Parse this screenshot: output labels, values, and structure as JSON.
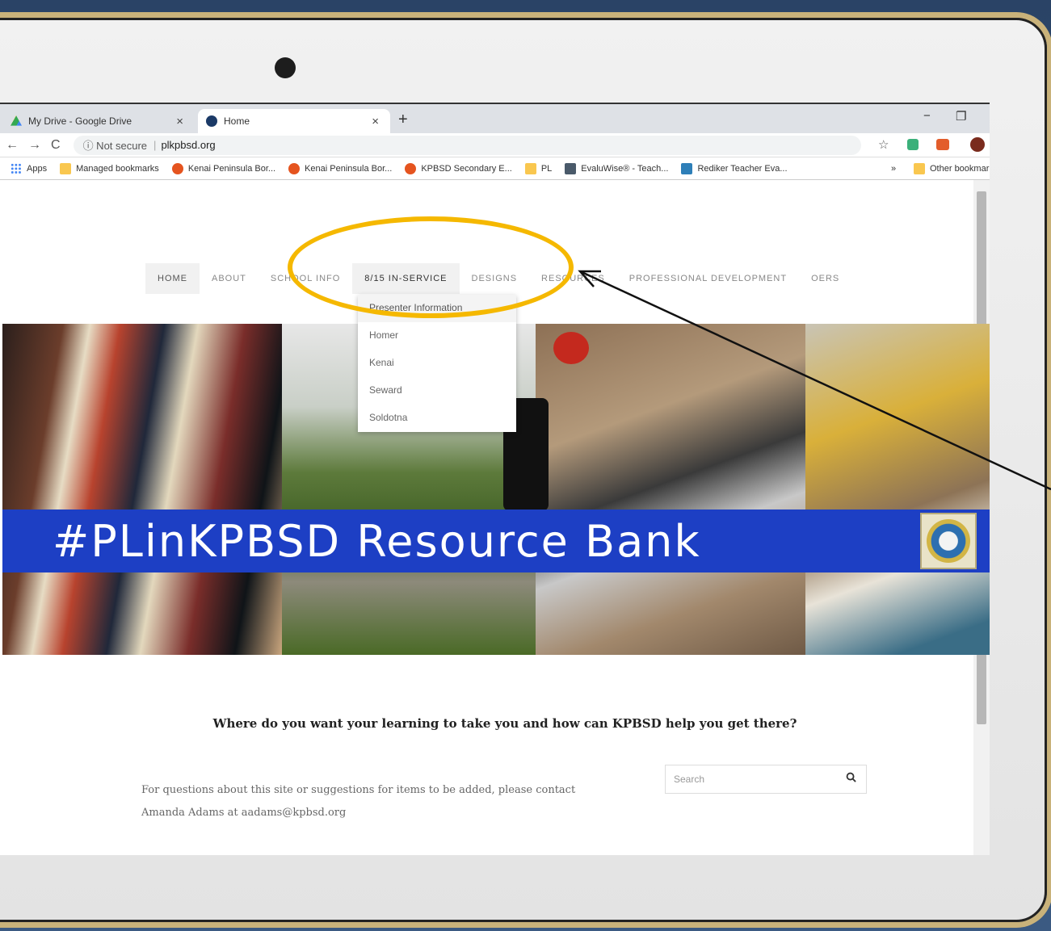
{
  "browser": {
    "tabs": [
      {
        "label": "My Drive - Google Drive",
        "close": "×"
      },
      {
        "label": "Home",
        "close": "×"
      }
    ],
    "new_tab": "+",
    "window_controls": [
      "−",
      "❐",
      "✕"
    ],
    "nav_buttons": [
      "←",
      "→",
      "C"
    ],
    "security_label": "ⓘ Not secure",
    "url": "plkpbsd.org",
    "star": "☆",
    "menu": "⋮",
    "bookmarks": [
      {
        "icon": "apps-grid-icon",
        "label": "Apps"
      },
      {
        "icon": "folder-icon",
        "label": "Managed bookmarks"
      },
      {
        "icon": "kpbsd-icon",
        "label": "Kenai Peninsula Bor..."
      },
      {
        "icon": "kpbsd-icon",
        "label": "Kenai Peninsula Bor..."
      },
      {
        "icon": "kpbsd-icon",
        "label": "KPBSD Secondary E..."
      },
      {
        "icon": "folder-icon",
        "label": "PL"
      },
      {
        "icon": "evaluwise-icon",
        "label": "EvaluWise® - Teach..."
      },
      {
        "icon": "rediker-icon",
        "label": "Rediker Teacher Eva..."
      }
    ],
    "overflow": "»",
    "other_bookmarks": "Other bookmarks"
  },
  "site": {
    "nav": [
      "HOME",
      "ABOUT",
      "SCHOOL INFO",
      "8/15 IN-SERVICE",
      "DESIGNS",
      "RESOURCES",
      "PROFESSIONAL DEVELOPMENT",
      "OERS"
    ],
    "dropdown": [
      "Presenter Information",
      "Homer",
      "Kenai",
      "Seward",
      "Soldotna"
    ],
    "banner_title": "#PLinKPBSD Resource Bank",
    "tagline": "Where do you want your learning to take you and how can KPBSD help you get there?",
    "contact_line1": "For questions about this site or suggestions for items to be added, please contact",
    "contact_line2": "Amanda Adams at aadams@kpbsd.org",
    "search_placeholder": "Search",
    "search_icon": "🔍"
  },
  "colors": {
    "banner": "#1d3fc4",
    "highlight_ellipse": "#f5b800",
    "frame_accent": "#c9b27a"
  }
}
